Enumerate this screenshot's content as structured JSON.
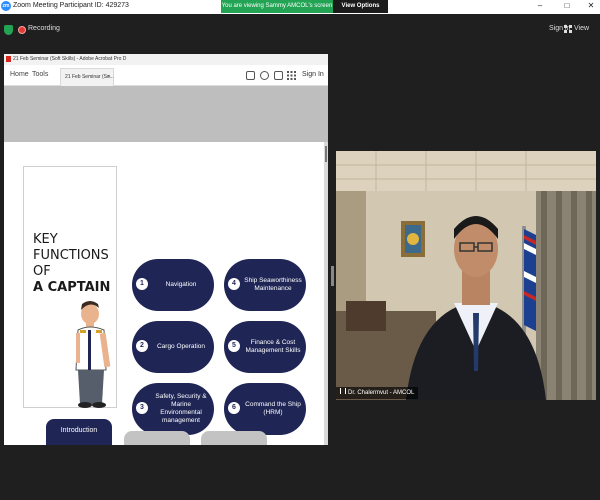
{
  "titlebar": {
    "title": "Zoom Meeting Participant ID: 429273",
    "banner": "You are viewing Sammy AMCOL's screen",
    "view_options": "View Options",
    "min": "–",
    "max": "□",
    "close": "✕"
  },
  "zoom_top": {
    "recording": "Recording",
    "sign_in": "Sign in",
    "view": "View"
  },
  "acrobat": {
    "window_title": "21 Feb Seminar (Soft Skills) - Adobe Acrobat Pro D",
    "tabs": [
      "Home",
      "Tools"
    ],
    "doc_tab": "21 Feb Seminar (So...",
    "doc_tab_close": "×",
    "sign_in": "Sign In"
  },
  "slide": {
    "title_lines": [
      "KEY",
      "FUNCTIONS OF",
      "A CAPTAIN"
    ],
    "functions": [
      {
        "num": "1",
        "label": "Navigation"
      },
      {
        "num": "2",
        "label": "Cargo Operation"
      },
      {
        "num": "3",
        "label": "Safety, Security & Marine Environmental management"
      },
      {
        "num": "4",
        "label": "Ship Seaworthiness Maintenance"
      },
      {
        "num": "5",
        "label": "Finance & Cost Management Skills"
      },
      {
        "num": "6",
        "label": "Command the Ship (HRM)"
      }
    ],
    "intro_button": "Introduction"
  },
  "video": {
    "participant_name": "Dr. Chalermvut - AMCOL"
  },
  "colors": {
    "navy": "#1f2656",
    "zoom_green": "#23a455",
    "zoom_blue": "#2d8cff"
  }
}
